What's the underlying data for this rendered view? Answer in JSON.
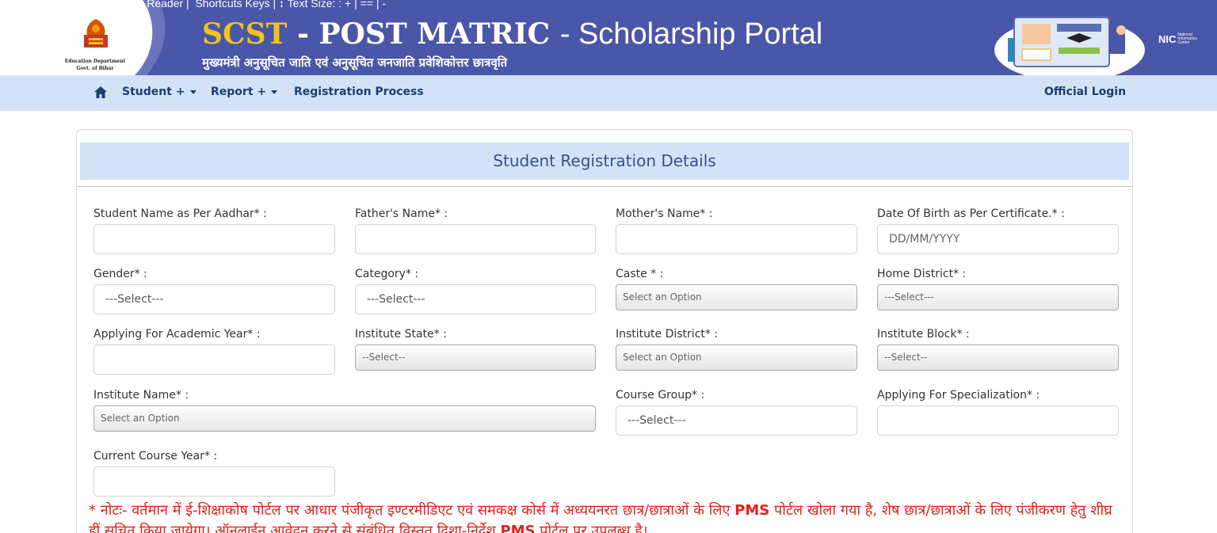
{
  "accessibility": {
    "text": "Screen Reader |  Shortcuts Keys | ↕ Text Size: : + | == | -"
  },
  "logo": {
    "dept_line1": "Education Department",
    "dept_line2": "Govt. of Bihar"
  },
  "header": {
    "title_scst": "SCST",
    "title_mid": " - POST MATRIC ",
    "title_portal": " - Scholarship Portal",
    "subtitle": "मुख्यमंत्री अनुसूचित जाति एवं अनुसूचित जनजाति  प्रवेशिकोत्तर छात्रवृति",
    "nic_label": "NIC",
    "nic_small": "National Informatics Centre"
  },
  "nav": {
    "student": "Student +",
    "report": "Report +",
    "registration": "Registration Process",
    "official_login": "Official Login"
  },
  "form": {
    "title": "Student Registration Details",
    "fields": {
      "student_name": {
        "label": "Student Name as Per Aadhar* :",
        "value": ""
      },
      "father_name": {
        "label": "Father's Name* :",
        "value": ""
      },
      "mother_name": {
        "label": "Mother's Name* :",
        "value": ""
      },
      "dob": {
        "label": "Date Of Birth as Per Certificate.* :",
        "placeholder": "DD/MM/YYYY"
      },
      "gender": {
        "label": "Gender* :",
        "value": "---Select---"
      },
      "category": {
        "label": "Category* :",
        "value": "---Select---"
      },
      "caste": {
        "label": "Caste * :",
        "value": "Select an Option"
      },
      "home_district": {
        "label": "Home District* :",
        "value": "---Select---"
      },
      "academic_year": {
        "label": "Applying For Academic Year* :",
        "value": ""
      },
      "institute_state": {
        "label": "Institute State* :",
        "value": "--Select--"
      },
      "institute_district": {
        "label": "Institute District* :",
        "value": "Select an Option"
      },
      "institute_block": {
        "label": "Institute Block* :",
        "value": "--Select--"
      },
      "institute_name": {
        "label": "Institute Name* :",
        "value": "Select an Option"
      },
      "course_group": {
        "label": "Course Group* :",
        "value": "---Select---"
      },
      "specialization": {
        "label": "Applying For Specialization* :",
        "value": ""
      },
      "current_course_year": {
        "label": "Current Course Year* :",
        "value": ""
      }
    }
  },
  "note": {
    "part1": "* नोटः- वर्तमान में ई-शिक्षाकोष पोर्टल पर आधार पंजीकृत इण्टरमीडिएट एवं समकक्ष कोर्स में अध्ययनरत छात्र/छात्राओं के लिए ",
    "pms1": "PMS",
    "part2": " पोर्टल खोला गया है, शेष छात्र/छात्राओं के लिए पंजीकरण हेतु शीघ्र हीं सूचित किया जायेगा। ऑनलाईन आवेदन करने से संबंधित विस्तृत दिशा-निर्देश ",
    "pms2": "PMS",
    "part3": " पोर्टल पर उपलब्ध है।"
  },
  "colors": {
    "header_bg": "#4a56a8",
    "nav_bg": "#d3e3f7",
    "accent_yellow": "#f0c419",
    "note_red": "#e0231c"
  }
}
